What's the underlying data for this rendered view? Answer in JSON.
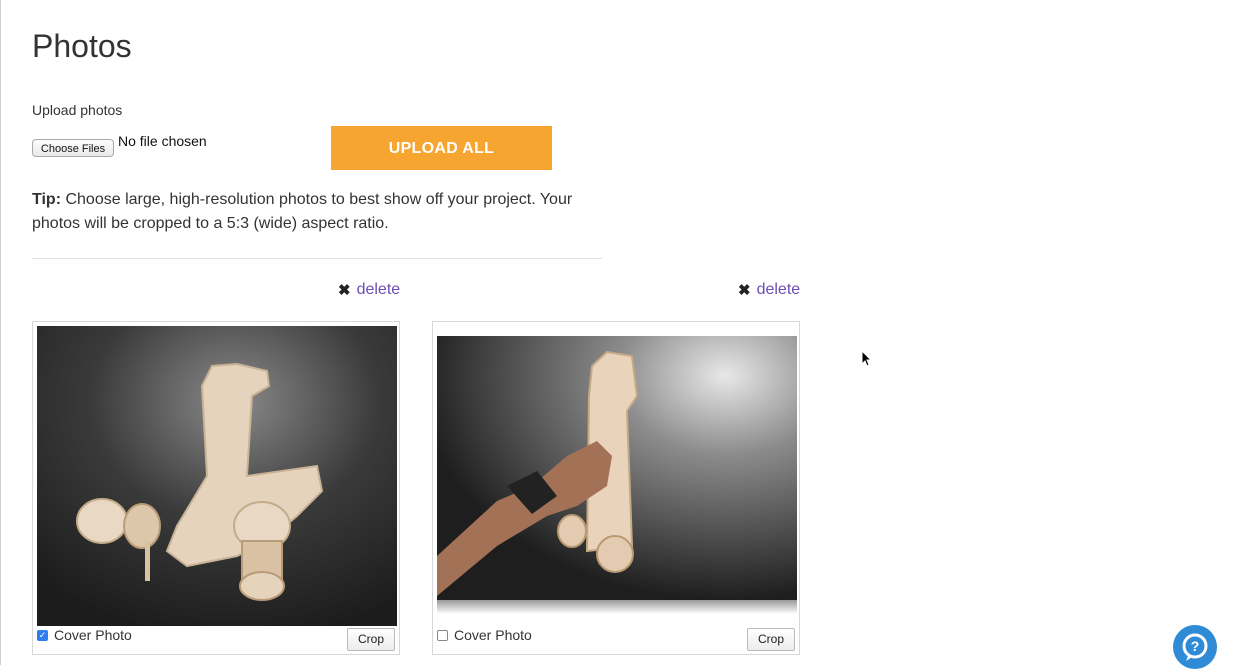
{
  "page": {
    "title": "Photos",
    "upload_label": "Upload photos",
    "choose_files_label": "Choose Files",
    "no_file_text": "No file chosen",
    "upload_all_label": "UPLOAD ALL",
    "tip_bold": "Tip:",
    "tip_text": " Choose large, high-resolution photos to best show off your project. Your photos will be cropped to a 5:3 (wide) aspect ratio."
  },
  "photos": [
    {
      "delete_icon": "✖",
      "delete_label": "delete",
      "cover_label": "Cover Photo",
      "cover_checked": true,
      "crop_label": "Crop"
    },
    {
      "delete_icon": "✖",
      "delete_label": "delete",
      "cover_label": "Cover Photo",
      "cover_checked": false,
      "crop_label": "Crop"
    }
  ],
  "colors": {
    "accent_orange": "#f5a530",
    "link_purple": "#6b4fb3",
    "help_blue": "#2f8bd6"
  },
  "icons": {
    "delete": "close-icon",
    "help": "help-chat-icon",
    "cursor": "mouse-pointer-icon"
  }
}
